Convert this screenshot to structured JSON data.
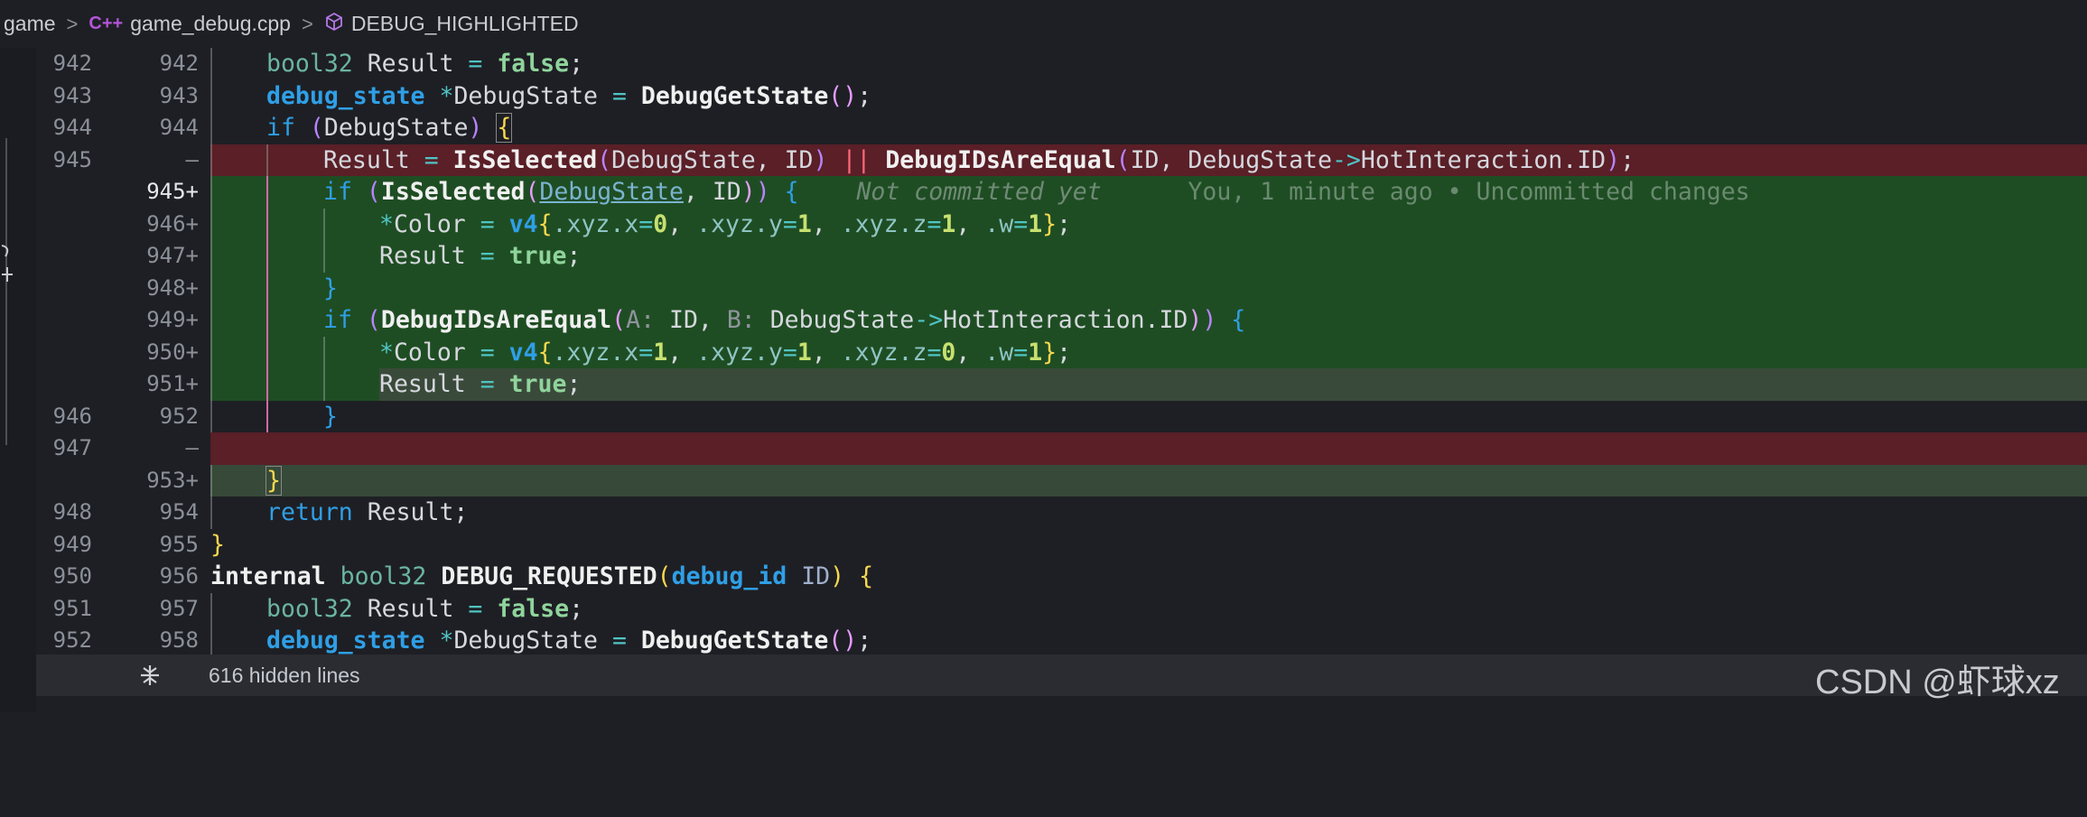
{
  "breadcrumb": {
    "folder": "game",
    "file": "game_debug.cpp",
    "symbol": "DEBUG_HIGHLIGHTED",
    "file_icon": "C++",
    "symbol_icon": "cube-icon"
  },
  "lines": {
    "l0": {
      "old": "942",
      "new": "942"
    },
    "l1": {
      "old": "943",
      "new": "943"
    },
    "l2": {
      "old": "944",
      "new": "944"
    },
    "l3": {
      "old": "945",
      "new": "—"
    },
    "l4": {
      "old": "",
      "new": "945+"
    },
    "l5": {
      "old": "",
      "new": "946+"
    },
    "l6": {
      "old": "",
      "new": "947+"
    },
    "l7": {
      "old": "",
      "new": "948+"
    },
    "l8": {
      "old": "",
      "new": "949+"
    },
    "l9": {
      "old": "",
      "new": "950+"
    },
    "l10": {
      "old": "",
      "new": "951+"
    },
    "l11": {
      "old": "946",
      "new": "952"
    },
    "l12": {
      "old": "947",
      "new": "—"
    },
    "l13": {
      "old": "",
      "new": "953+"
    },
    "l14": {
      "old": "948",
      "new": "954"
    },
    "l15": {
      "old": "949",
      "new": "955"
    },
    "l16": {
      "old": "950",
      "new": "956"
    },
    "l17": {
      "old": "951",
      "new": "957"
    },
    "l18": {
      "old": "952",
      "new": "958"
    }
  },
  "blame": {
    "status": "Not committed yet",
    "info": "You, 1 minute ago • Uncommitted changes"
  },
  "hidden_lines": "616 hidden lines",
  "watermark": "CSDN @虾球xz",
  "colors": {
    "deleted": "#5a1f27",
    "added": "#1f4d23",
    "keyword": "#2f9fe6",
    "background": "#1e1f24"
  }
}
